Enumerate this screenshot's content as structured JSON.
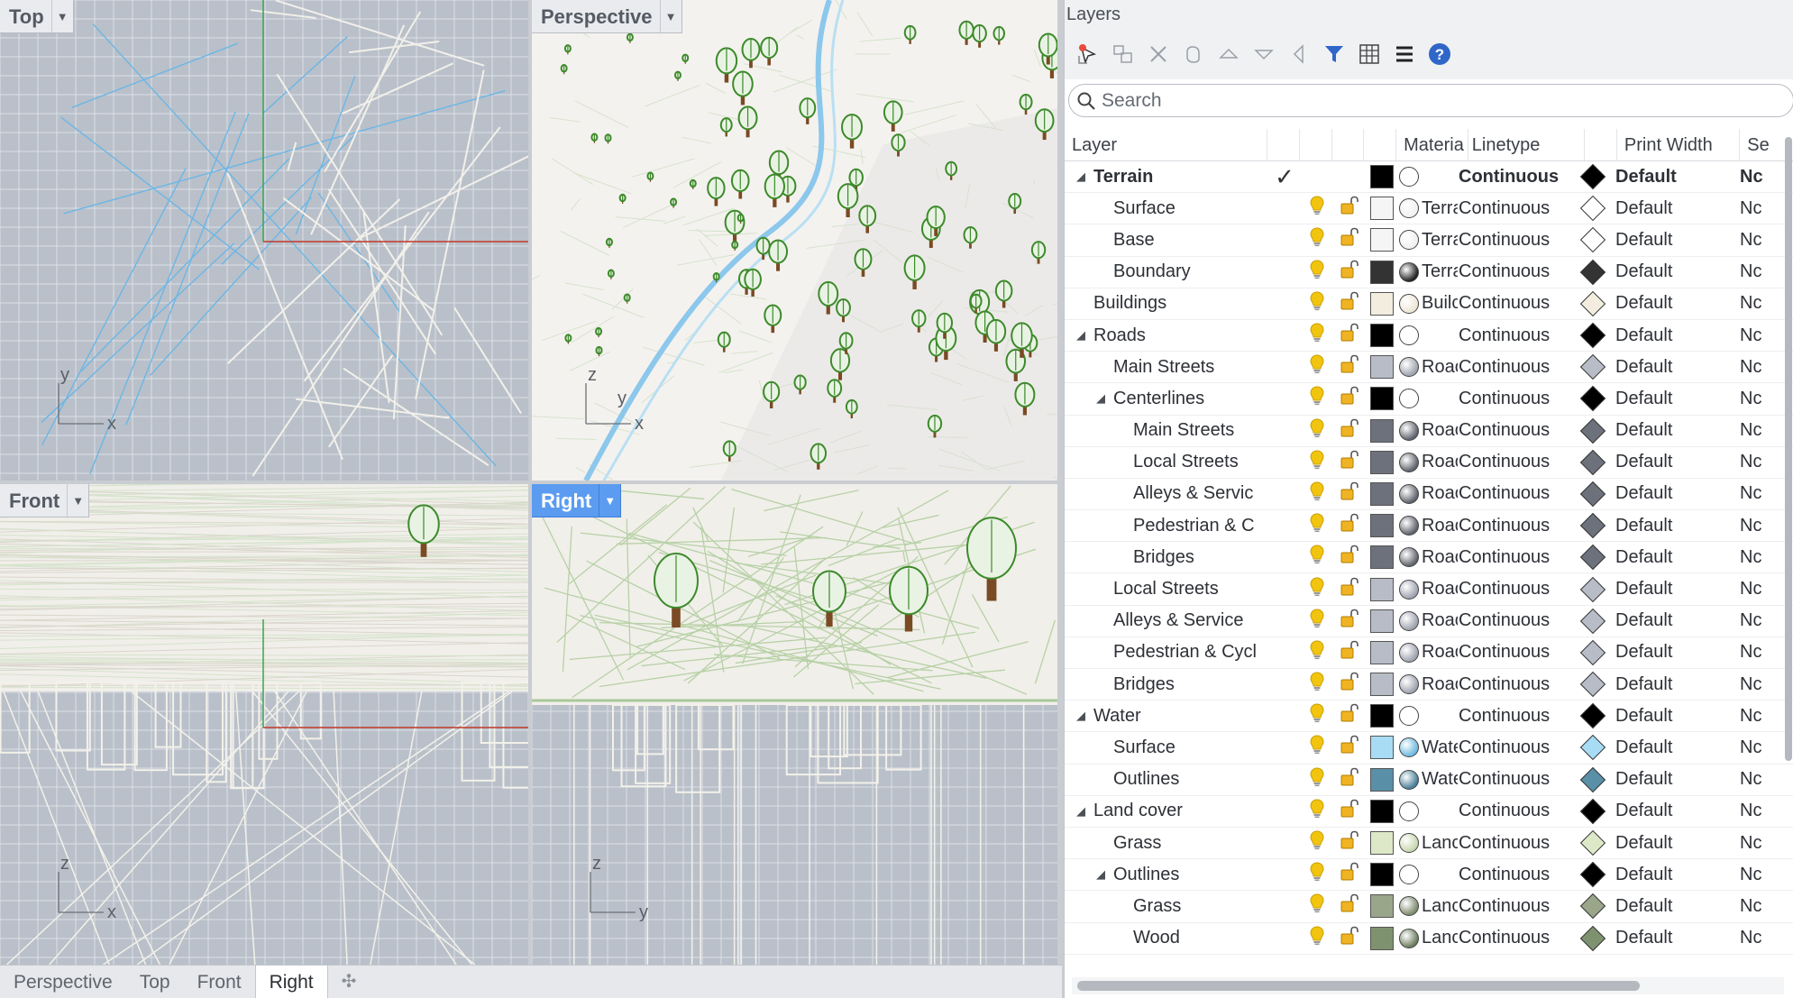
{
  "viewports": {
    "top": {
      "title": "Top",
      "axis_a": "y",
      "axis_b": "x"
    },
    "perspective": {
      "title": "Perspective",
      "axis_a": "z",
      "axis_b": "y",
      "axis_c": "x"
    },
    "front": {
      "title": "Front",
      "axis_a": "z",
      "axis_b": "x"
    },
    "right": {
      "title": "Right",
      "axis_a": "z",
      "axis_b": "y"
    }
  },
  "bottom_tabs": [
    "Perspective",
    "Top",
    "Front",
    "Right"
  ],
  "active_bottom_tab": "Right",
  "layers_panel": {
    "title": "Layers",
    "search_placeholder": "Search",
    "columns": {
      "layer": "Layer",
      "material": "Materia",
      "linetype": "Linetype",
      "print_width": "Print Width",
      "section": "Se"
    },
    "rows": [
      {
        "name": "Terrain",
        "indent": 0,
        "expand": "open",
        "current": true,
        "color": "#000000",
        "material": "",
        "sphere": "#ffffff",
        "linetype": "Continuous",
        "print_color": "#000000",
        "print_width": "Default",
        "section": "Nc",
        "bold": true
      },
      {
        "name": "Surface",
        "indent": 1,
        "expand": "",
        "color": "#f5f5f5",
        "material": "Terra",
        "sphere": "#f0f0f0",
        "linetype": "Continuous",
        "print_color": "#ffffff",
        "print_width": "Default",
        "section": "Nc"
      },
      {
        "name": "Base",
        "indent": 1,
        "expand": "",
        "color": "#f5f5f5",
        "material": "Terra",
        "sphere": "#f0f0f0",
        "linetype": "Continuous",
        "print_color": "#ffffff",
        "print_width": "Default",
        "section": "Nc"
      },
      {
        "name": "Boundary",
        "indent": 1,
        "expand": "",
        "color": "#333333",
        "material": "Terra",
        "sphere": "#222222",
        "linetype": "Continuous",
        "print_color": "#333333",
        "print_width": "Default",
        "section": "Nc"
      },
      {
        "name": "Buildings",
        "indent": 0,
        "expand": "",
        "color": "#f3ede0",
        "material": "Builc",
        "sphere": "#ede6d6",
        "linetype": "Continuous",
        "print_color": "#f3ede0",
        "print_width": "Default",
        "section": "Nc"
      },
      {
        "name": "Roads",
        "indent": 0,
        "expand": "open",
        "color": "#000000",
        "material": "",
        "sphere": "#ffffff",
        "linetype": "Continuous",
        "print_color": "#000000",
        "print_width": "Default",
        "section": "Nc"
      },
      {
        "name": "Main Streets",
        "indent": 1,
        "expand": "",
        "color": "#b8bcc7",
        "material": "Roac",
        "sphere": "#9ea3ae",
        "linetype": "Continuous",
        "print_color": "#b8bcc7",
        "print_width": "Default",
        "section": "Nc"
      },
      {
        "name": "Centerlines",
        "indent": 1,
        "expand": "open",
        "color": "#000000",
        "material": "",
        "sphere": "#ffffff",
        "linetype": "Continuous",
        "print_color": "#000000",
        "print_width": "Default",
        "section": "Nc"
      },
      {
        "name": "Main Streets",
        "indent": 2,
        "expand": "",
        "color": "#6d717b",
        "material": "Roac",
        "sphere": "#5f636c",
        "linetype": "Continuous",
        "print_color": "#6d717b",
        "print_width": "Default",
        "section": "Nc"
      },
      {
        "name": "Local Streets",
        "indent": 2,
        "expand": "",
        "color": "#6d717b",
        "material": "Roac",
        "sphere": "#5f636c",
        "linetype": "Continuous",
        "print_color": "#6d717b",
        "print_width": "Default",
        "section": "Nc"
      },
      {
        "name": "Alleys & Servic",
        "indent": 2,
        "expand": "",
        "color": "#6d717b",
        "material": "Roac",
        "sphere": "#5f636c",
        "linetype": "Continuous",
        "print_color": "#6d717b",
        "print_width": "Default",
        "section": "Nc"
      },
      {
        "name": "Pedestrian & C",
        "indent": 2,
        "expand": "",
        "color": "#6d717b",
        "material": "Roac",
        "sphere": "#5f636c",
        "linetype": "Continuous",
        "print_color": "#6d717b",
        "print_width": "Default",
        "section": "Nc"
      },
      {
        "name": "Bridges",
        "indent": 2,
        "expand": "",
        "color": "#6d717b",
        "material": "Roac",
        "sphere": "#5f636c",
        "linetype": "Continuous",
        "print_color": "#6d717b",
        "print_width": "Default",
        "section": "Nc"
      },
      {
        "name": "Local Streets",
        "indent": 1,
        "expand": "",
        "color": "#b8bcc7",
        "material": "Roac",
        "sphere": "#9ea3ae",
        "linetype": "Continuous",
        "print_color": "#b8bcc7",
        "print_width": "Default",
        "section": "Nc"
      },
      {
        "name": "Alleys & Service",
        "indent": 1,
        "expand": "",
        "color": "#b8bcc7",
        "material": "Roac",
        "sphere": "#9ea3ae",
        "linetype": "Continuous",
        "print_color": "#b8bcc7",
        "print_width": "Default",
        "section": "Nc"
      },
      {
        "name": "Pedestrian & Cycl",
        "indent": 1,
        "expand": "",
        "color": "#b8bcc7",
        "material": "Roac",
        "sphere": "#9ea3ae",
        "linetype": "Continuous",
        "print_color": "#b8bcc7",
        "print_width": "Default",
        "section": "Nc"
      },
      {
        "name": "Bridges",
        "indent": 1,
        "expand": "",
        "color": "#b8bcc7",
        "material": "Roac",
        "sphere": "#9ea3ae",
        "linetype": "Continuous",
        "print_color": "#b8bcc7",
        "print_width": "Default",
        "section": "Nc"
      },
      {
        "name": "Water",
        "indent": 0,
        "expand": "open",
        "color": "#000000",
        "material": "",
        "sphere": "#ffffff",
        "linetype": "Continuous",
        "print_color": "#000000",
        "print_width": "Default",
        "section": "Nc"
      },
      {
        "name": "Surface",
        "indent": 1,
        "expand": "",
        "color": "#a8dcf5",
        "material": "Wate",
        "sphere": "#6fb9df",
        "linetype": "Continuous",
        "print_color": "#a8dcf5",
        "print_width": "Default",
        "section": "Nc"
      },
      {
        "name": "Outlines",
        "indent": 1,
        "expand": "",
        "color": "#5a8fa8",
        "material": "Wate",
        "sphere": "#4b7f98",
        "linetype": "Continuous",
        "print_color": "#5a8fa8",
        "print_width": "Default",
        "section": "Nc"
      },
      {
        "name": "Land cover",
        "indent": 0,
        "expand": "open",
        "color": "#000000",
        "material": "",
        "sphere": "#ffffff",
        "linetype": "Continuous",
        "print_color": "#000000",
        "print_width": "Default",
        "section": "Nc"
      },
      {
        "name": "Grass",
        "indent": 1,
        "expand": "",
        "color": "#dde8c8",
        "material": "Lanc",
        "sphere": "#c9d6ae",
        "linetype": "Continuous",
        "print_color": "#dde8c8",
        "print_width": "Default",
        "section": "Nc"
      },
      {
        "name": "Outlines",
        "indent": 1,
        "expand": "open",
        "color": "#000000",
        "material": "",
        "sphere": "#ffffff",
        "linetype": "Continuous",
        "print_color": "#000000",
        "print_width": "Default",
        "section": "Nc"
      },
      {
        "name": "Grass",
        "indent": 2,
        "expand": "",
        "color": "#9aa68a",
        "material": "Lanc",
        "sphere": "#7e8b6e",
        "linetype": "Continuous",
        "print_color": "#9aa68a",
        "print_width": "Default",
        "section": "Nc"
      },
      {
        "name": "Wood",
        "indent": 2,
        "expand": "",
        "color": "#7f9270",
        "material": "Lanc",
        "sphere": "#6b7d5d",
        "linetype": "Continuous",
        "print_color": "#7f9270",
        "print_width": "Default",
        "section": "Nc"
      }
    ]
  },
  "colors": {
    "layer_on_bulb": "#f1c40f",
    "lock_icon": "#e6a817",
    "active_viewport_tab": "#5b9cf0",
    "filter_icon": "#2f67c9",
    "help_icon": "#2f67c9"
  }
}
